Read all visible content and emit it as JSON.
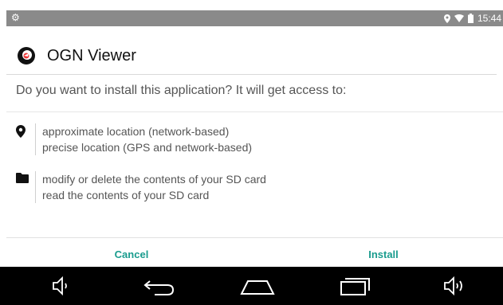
{
  "status_bar": {
    "time": "15:44",
    "icons": [
      "usb-debug-icon",
      "location-icon",
      "wifi-icon",
      "battery-icon"
    ]
  },
  "app": {
    "name": "OGN Viewer",
    "icon": "ogn-viewer-app-icon"
  },
  "installer": {
    "question": "Do you want to install this application? It will get access to:",
    "permission_groups": [
      {
        "icon": "location-pin-icon",
        "items": [
          "approximate location (network-based)",
          "precise location (GPS and network-based)"
        ]
      },
      {
        "icon": "folder-icon",
        "items": [
          "modify or delete the contents of your SD card",
          "read the contents of your SD card"
        ]
      }
    ],
    "buttons": {
      "cancel": "Cancel",
      "install": "Install"
    }
  },
  "nav_bar": {
    "icons": [
      "volume-down-icon",
      "back-icon",
      "home-icon",
      "recents-icon",
      "volume-up-icon"
    ]
  },
  "colors": {
    "accent": "#1a9c8e",
    "status_bar": "#8a8a8a",
    "nav_bar": "#000000"
  }
}
